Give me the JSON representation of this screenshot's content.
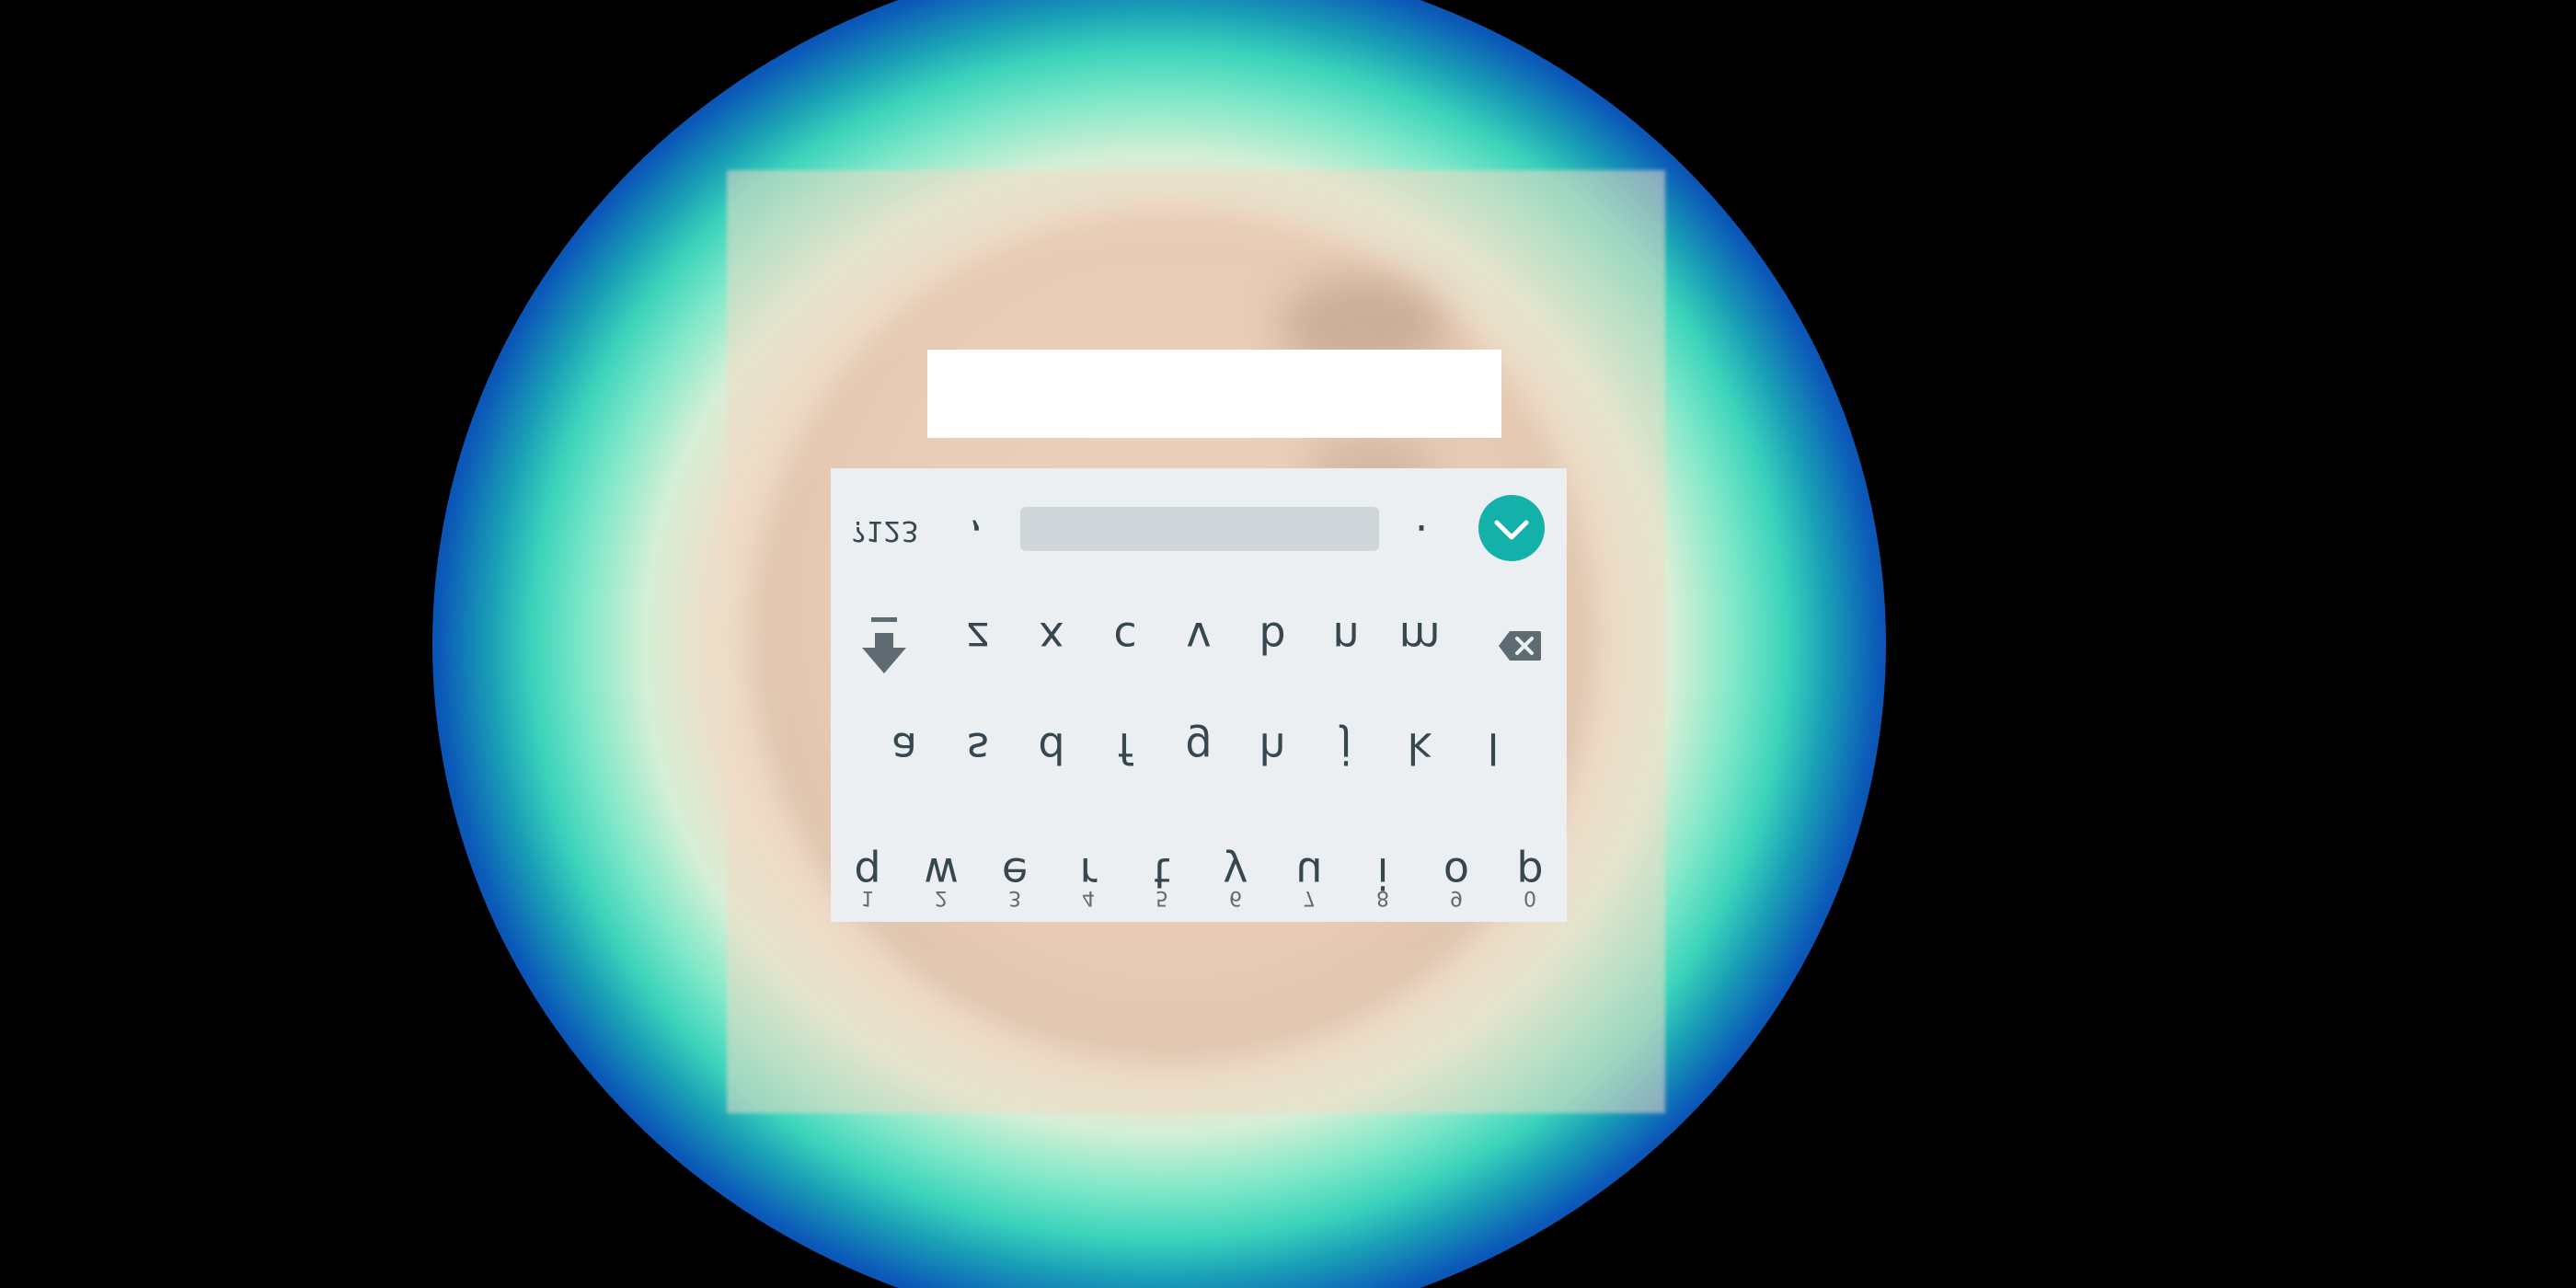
{
  "keyboard": {
    "top_row": [
      {
        "letter": "q",
        "hint": "1"
      },
      {
        "letter": "w",
        "hint": "2"
      },
      {
        "letter": "e",
        "hint": "3"
      },
      {
        "letter": "r",
        "hint": "4"
      },
      {
        "letter": "t",
        "hint": "5"
      },
      {
        "letter": "y",
        "hint": "6"
      },
      {
        "letter": "u",
        "hint": "7"
      },
      {
        "letter": "i",
        "hint": "8"
      },
      {
        "letter": "o",
        "hint": "9"
      },
      {
        "letter": "p",
        "hint": "0"
      }
    ],
    "middle_row": [
      "a",
      "s",
      "d",
      "f",
      "g",
      "h",
      "j",
      "k",
      "l"
    ],
    "bottom_row": [
      "z",
      "x",
      "c",
      "v",
      "b",
      "n",
      "m"
    ],
    "symbols_label": "?123",
    "comma_label": ",",
    "period_label": ".",
    "shift_icon": "shift-arrow-icon",
    "backspace_icon": "backspace-icon",
    "enter_icon": "enter-arrow-icon",
    "accent_color": "#14b0aa"
  },
  "text_field": {
    "value": ""
  }
}
